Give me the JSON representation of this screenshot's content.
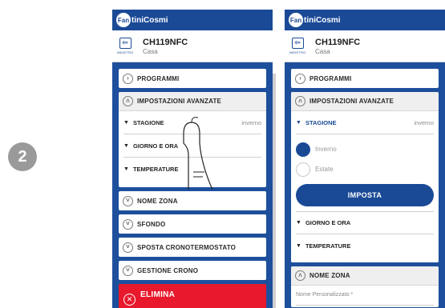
{
  "step": "2",
  "brand": "FantiniCosmi",
  "left_phone": {
    "back_label": "INDIETRO",
    "device_name": "CH119NFC",
    "device_location": "Casa",
    "programs": "PROGRAMMI",
    "advanced": "IMPOSTAZIONI AVANZATE",
    "season": {
      "label": "STAGIONE",
      "value": "inverno"
    },
    "date_time": "GIORNO E ORA",
    "temperatures": "TEMPERATURE",
    "zone_name": "NOME ZONA",
    "background": "SFONDO",
    "move_thermostat": "SPOSTA CRONOTERMOSTATO",
    "schedule_mgmt": "GESTIONE CRONO",
    "delete": "ELIMINA"
  },
  "right_phone": {
    "back_label": "INDIETRO",
    "device_name": "CH119NFC",
    "device_location": "Casa",
    "programs": "PROGRAMMI",
    "advanced": "IMPOSTAZIONI AVANZATE",
    "season": {
      "label": "STAGIONE",
      "value": "inverno"
    },
    "season_options": {
      "winter": "Inverno",
      "summer": "Estate",
      "selected": "Inverno"
    },
    "set_button": "IMPOSTA",
    "date_time": "GIORNO E ORA",
    "temperatures": "TEMPERATURE",
    "zone_name": "NOME ZONA",
    "custom_name_label": "Nome Personalizzato *"
  },
  "colors": {
    "primary": "#1a4a96",
    "danger": "#e8192c",
    "badge": "#9a9a9a"
  }
}
